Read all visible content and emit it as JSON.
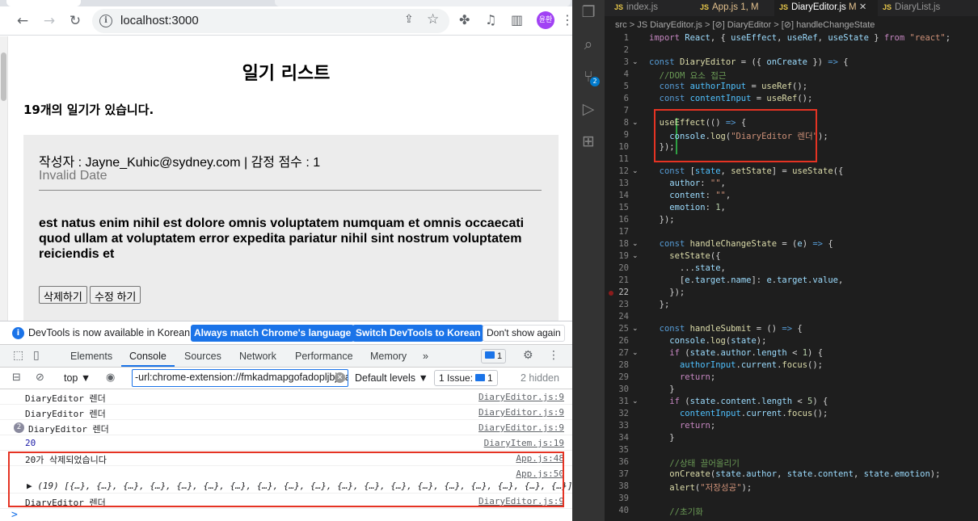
{
  "browser": {
    "url": "localhost:3000",
    "profile_label": "윤환",
    "page": {
      "title": "일기 리스트",
      "count_text": "19개의 일기가 있습니다.",
      "item": {
        "info_line": "작성자 : Jayne_Kuhic@sydney.com | 감정 점수 : 1",
        "date": "Invalid Date",
        "content": "est natus enim nihil est dolore omnis voluptatem numquam et omnis occaecati quod ullam at voluptatem error expedita pariatur nihil sint nostrum voluptatem reiciendis et",
        "delete_label": "삭제하기",
        "edit_label": "수정 하기"
      }
    }
  },
  "devtools": {
    "banner": {
      "message": "DevTools is now available in Korean!",
      "btn_match": "Always match Chrome's language",
      "btn_switch": "Switch DevTools to Korean",
      "btn_dismiss": "Don't show again"
    },
    "tabs": [
      "Elements",
      "Console",
      "Sources",
      "Network",
      "Performance",
      "Memory"
    ],
    "more_tabs": "»",
    "issues_badge": "1",
    "filter": {
      "context": "top ▼",
      "filter_value": "-url:chrome-extension://fmkadmapgofadopljbjfkapdkoienihi",
      "levels": "Default levels ▼",
      "issue_label": "1 Issue:",
      "issue_count": "1",
      "hidden": "2 hidden"
    },
    "console": [
      {
        "msg": "DiaryEditor 렌더",
        "src": "DiaryEditor.js:9"
      },
      {
        "msg": "DiaryEditor 렌더",
        "src": "DiaryEditor.js:9"
      },
      {
        "msg": "DiaryEditor 렌더",
        "src": "DiaryEditor.js:9",
        "repeat": "2"
      },
      {
        "msg": "20",
        "src": "DiaryItem.js:19"
      },
      {
        "msg": "20가 삭제되었습니다",
        "src": "App.js:48"
      },
      {
        "msg": "",
        "src": "App.js:50"
      },
      {
        "msg": "▶ (19) [{…}, {…}, {…}, {…}, {…}, {…}, {…}, {…}, {…}, {…}, {…}, {…}, {…}, {…}, {…}, {…}, {…}, {…}, {…}]",
        "src": ""
      },
      {
        "msg": "DiaryEditor 렌더",
        "src": "DiaryEditor.js:9"
      }
    ],
    "prompt": ">"
  },
  "vscode": {
    "tabs": [
      {
        "label": "index.js",
        "mod": ""
      },
      {
        "label": "App.js",
        "mod": "1, M"
      },
      {
        "label": "DiaryEditor.js",
        "mod": "M"
      },
      {
        "label": "DiaryList.js",
        "mod": ""
      }
    ],
    "breadcrumb": "src > JS DiaryEditor.js > [⊘] DiaryEditor > [⊘] handleChangeState",
    "line_numbers": [
      "1",
      "2",
      "3",
      "4",
      "5",
      "6",
      "7",
      "8",
      "9",
      "10",
      "11",
      "12",
      "13",
      "14",
      "15",
      "16",
      "17",
      "18",
      "19",
      "20",
      "21",
      "22",
      "23",
      "24",
      "25",
      "26",
      "27",
      "28",
      "29",
      "30",
      "31",
      "32",
      "33",
      "34",
      "35",
      "36",
      "37",
      "38",
      "39",
      "40"
    ],
    "code_text": {
      "l4_comment": "//DOM 요소 접근",
      "l9_string": "\"DiaryEditor 렌더\"",
      "l36_comment": "//상태 끌어올리기",
      "l38_string": "\"저장성공\"",
      "l40_comment": "//초기화"
    }
  }
}
